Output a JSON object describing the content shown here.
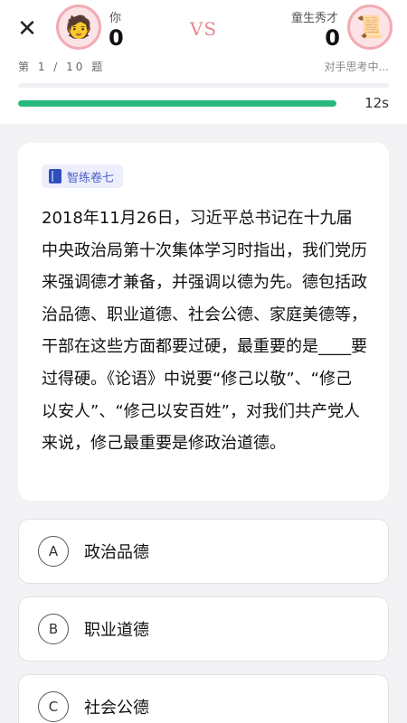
{
  "header": {
    "close_label": "✕",
    "me": {
      "name": "你",
      "score": "0",
      "avatar_icon": "🧑"
    },
    "vs_label": "VS",
    "opponent": {
      "name": "童生秀才",
      "score": "0",
      "avatar_icon": "📜"
    },
    "question_counter": "第 1 / 10 题",
    "opponent_status": "对手思考中...",
    "timer": "12s",
    "timer_progress_fraction": 1.0
  },
  "question": {
    "tag_label": "智练卷七",
    "tag_icon": "book-icon",
    "text": "2018年11月26日，习近平总书记在十九届中央政治局第十次集体学习时指出，我们党历来强调德才兼备，并强调以德为先。德包括政治品德、职业道德、社会公德、家庭美德等，干部在这些方面都要过硬，最重要的是____要过得硬。《论语》中说要“修己以敬”、“修己以安人”、“修己以安百姓”，对我们共产党人来说，修己最重要是修政治道德。"
  },
  "options": [
    {
      "letter": "A",
      "text": "政治品德"
    },
    {
      "letter": "B",
      "text": "职业道德"
    },
    {
      "letter": "C",
      "text": "社会公德"
    }
  ],
  "colors": {
    "accent_green": "#27b87e",
    "vs_pink": "#e7878f",
    "tag_blue": "#4a5ec9"
  }
}
